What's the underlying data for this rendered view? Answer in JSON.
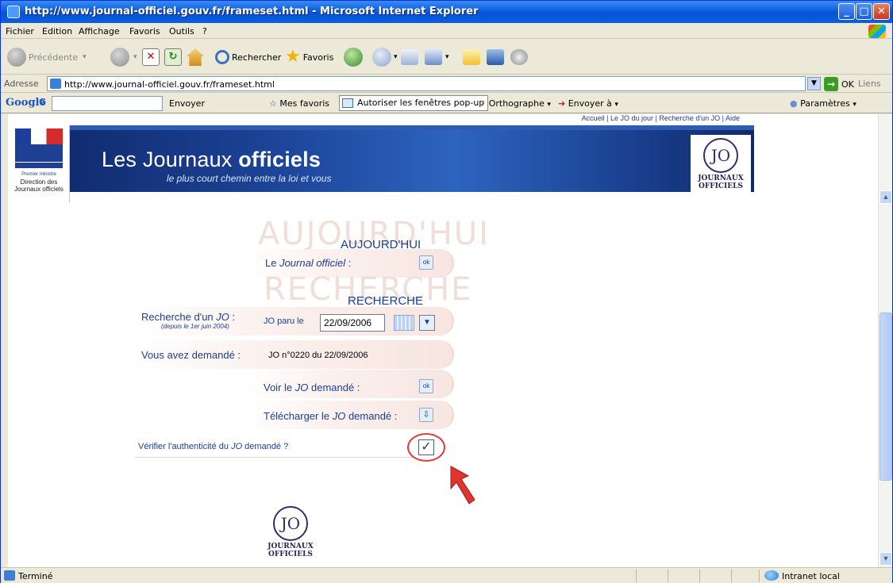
{
  "window": {
    "title": "http://www.journal-officiel.gouv.fr/frameset.html - Microsoft Internet Explorer"
  },
  "menu": [
    "Fichier",
    "Edition",
    "Affichage",
    "Favoris",
    "Outils",
    "?"
  ],
  "toolbar": {
    "back_label": "Précédente",
    "search_label": "Rechercher",
    "favorites_label": "Favoris"
  },
  "address": {
    "label": "Adresse",
    "url": "http://www.journal-officiel.gouv.fr/frameset.html",
    "go_label": "OK",
    "links_label": "Liens"
  },
  "googlebar": {
    "logo": "Google",
    "g_label": "G",
    "send_label": "Envoyer",
    "favorites_label": "Mes favoris",
    "popup_label": "Autoriser les fenêtres pop-up",
    "spell_label": "Orthographe",
    "sendto_label": "Envoyer à",
    "settings_label": "Paramètres"
  },
  "site": {
    "top_links": "Accueil | Le JO du jour | Recherche d'un JO | Aide",
    "org_line1": "Premier ministre",
    "org_line2": "Direction des Journaux officiels",
    "title_normal": "Les Journaux ",
    "title_bold": "officiels",
    "subtitle": "le plus court chemin entre la loi et vous",
    "jo_mark": "JO",
    "jo_text1": "JOURNAUX",
    "jo_text2": "OFFICIELS"
  },
  "form": {
    "today_ghost": "AUJOURD'HUI",
    "today_title": "AUJOURD'HUI",
    "today_label_prefix": "Le ",
    "today_label_italic": "Journal officiel",
    "today_label_suffix": " :",
    "ok": "ok",
    "search_ghost": "RECHERCHE",
    "search_title": "RECHERCHE",
    "search_label_prefix": "Recherche d'un ",
    "search_label_italic": "JO",
    "search_label_suffix": " :",
    "search_note": "(depuis le 1er juin 2004)",
    "date_label": "JO paru le",
    "date_value": "22/09/2006",
    "asked_label": "Vous avez demandé :",
    "asked_value": "JO n°0220 du 22/09/2006",
    "view_prefix": "Voir le ",
    "view_italic": "JO",
    "view_suffix": " demandé :",
    "download_prefix": "Télécharger le ",
    "download_italic": "JO",
    "download_suffix": " demandé :",
    "verify_prefix": "Vérifier l'authenticité du ",
    "verify_italic": "JO",
    "verify_suffix": " demandé ?"
  },
  "status": {
    "text": "Terminé",
    "zone": "Intranet local"
  }
}
